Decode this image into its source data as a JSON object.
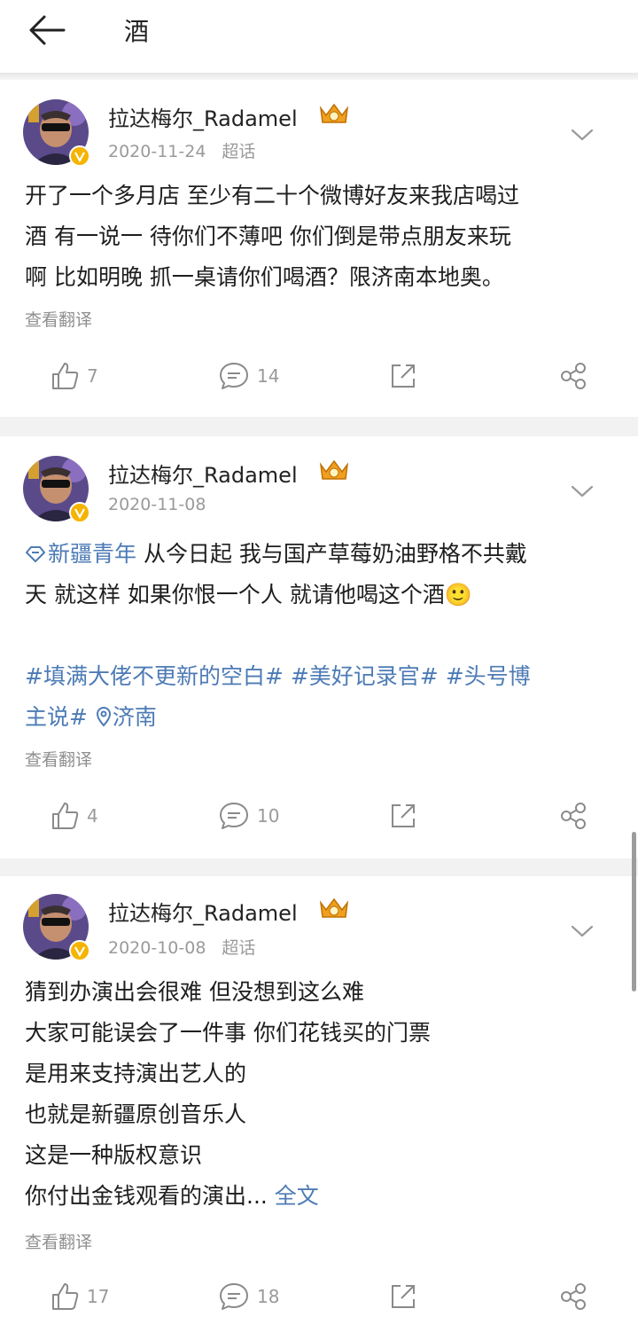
{
  "header": {
    "title": "酒",
    "back_icon": "arrow-left-icon"
  },
  "posts": [
    {
      "author": "拉达梅尔_Radamel",
      "date": "2020-11-24",
      "source": "超话",
      "lines": [
        "开了一个多月店 至少有二十个微博好友来我店喝过",
        "酒 有一说一 待你们不薄吧 你们倒是带点朋友来玩",
        "啊 比如明晚 抓一桌请你们喝酒？限济南本地奥。"
      ],
      "translate": "查看翻译",
      "likes": "7",
      "comments": "14"
    },
    {
      "author": "拉达梅尔_Radamel",
      "date": "2020-11-08",
      "source": "",
      "topic": "新疆青年",
      "line1_rest": " 从今日起 我与国产草莓奶油野格不共戴",
      "line2": "天 就这样 如果你恨一个人 就请他喝这个酒",
      "emoji": "🙂",
      "tag1": "#填满大佬不更新的空白#",
      "tag2": "#美好记录官#",
      "tag3_part1": "#头号博",
      "tag3_part2": "主说#",
      "location": "济南",
      "translate": "查看翻译",
      "likes": "4",
      "comments": "10"
    },
    {
      "author": "拉达梅尔_Radamel",
      "date": "2020-10-08",
      "source": "超话",
      "lines": [
        "猜到办演出会很难 但没想到这么难",
        "大家可能误会了一件事 你们花钱买的门票",
        "是用来支持演出艺人的",
        "也就是新疆原创音乐人",
        "这是一种版权意识"
      ],
      "last_line": "你付出金钱观看的演出... ",
      "full_text": "全文",
      "translate": "查看翻译",
      "likes": "17",
      "comments": "18"
    }
  ],
  "colors": {
    "link": "#4d7bb5",
    "meta": "#9a9a9a",
    "divider": "#f2f2f2",
    "badge": "#f5b400"
  }
}
